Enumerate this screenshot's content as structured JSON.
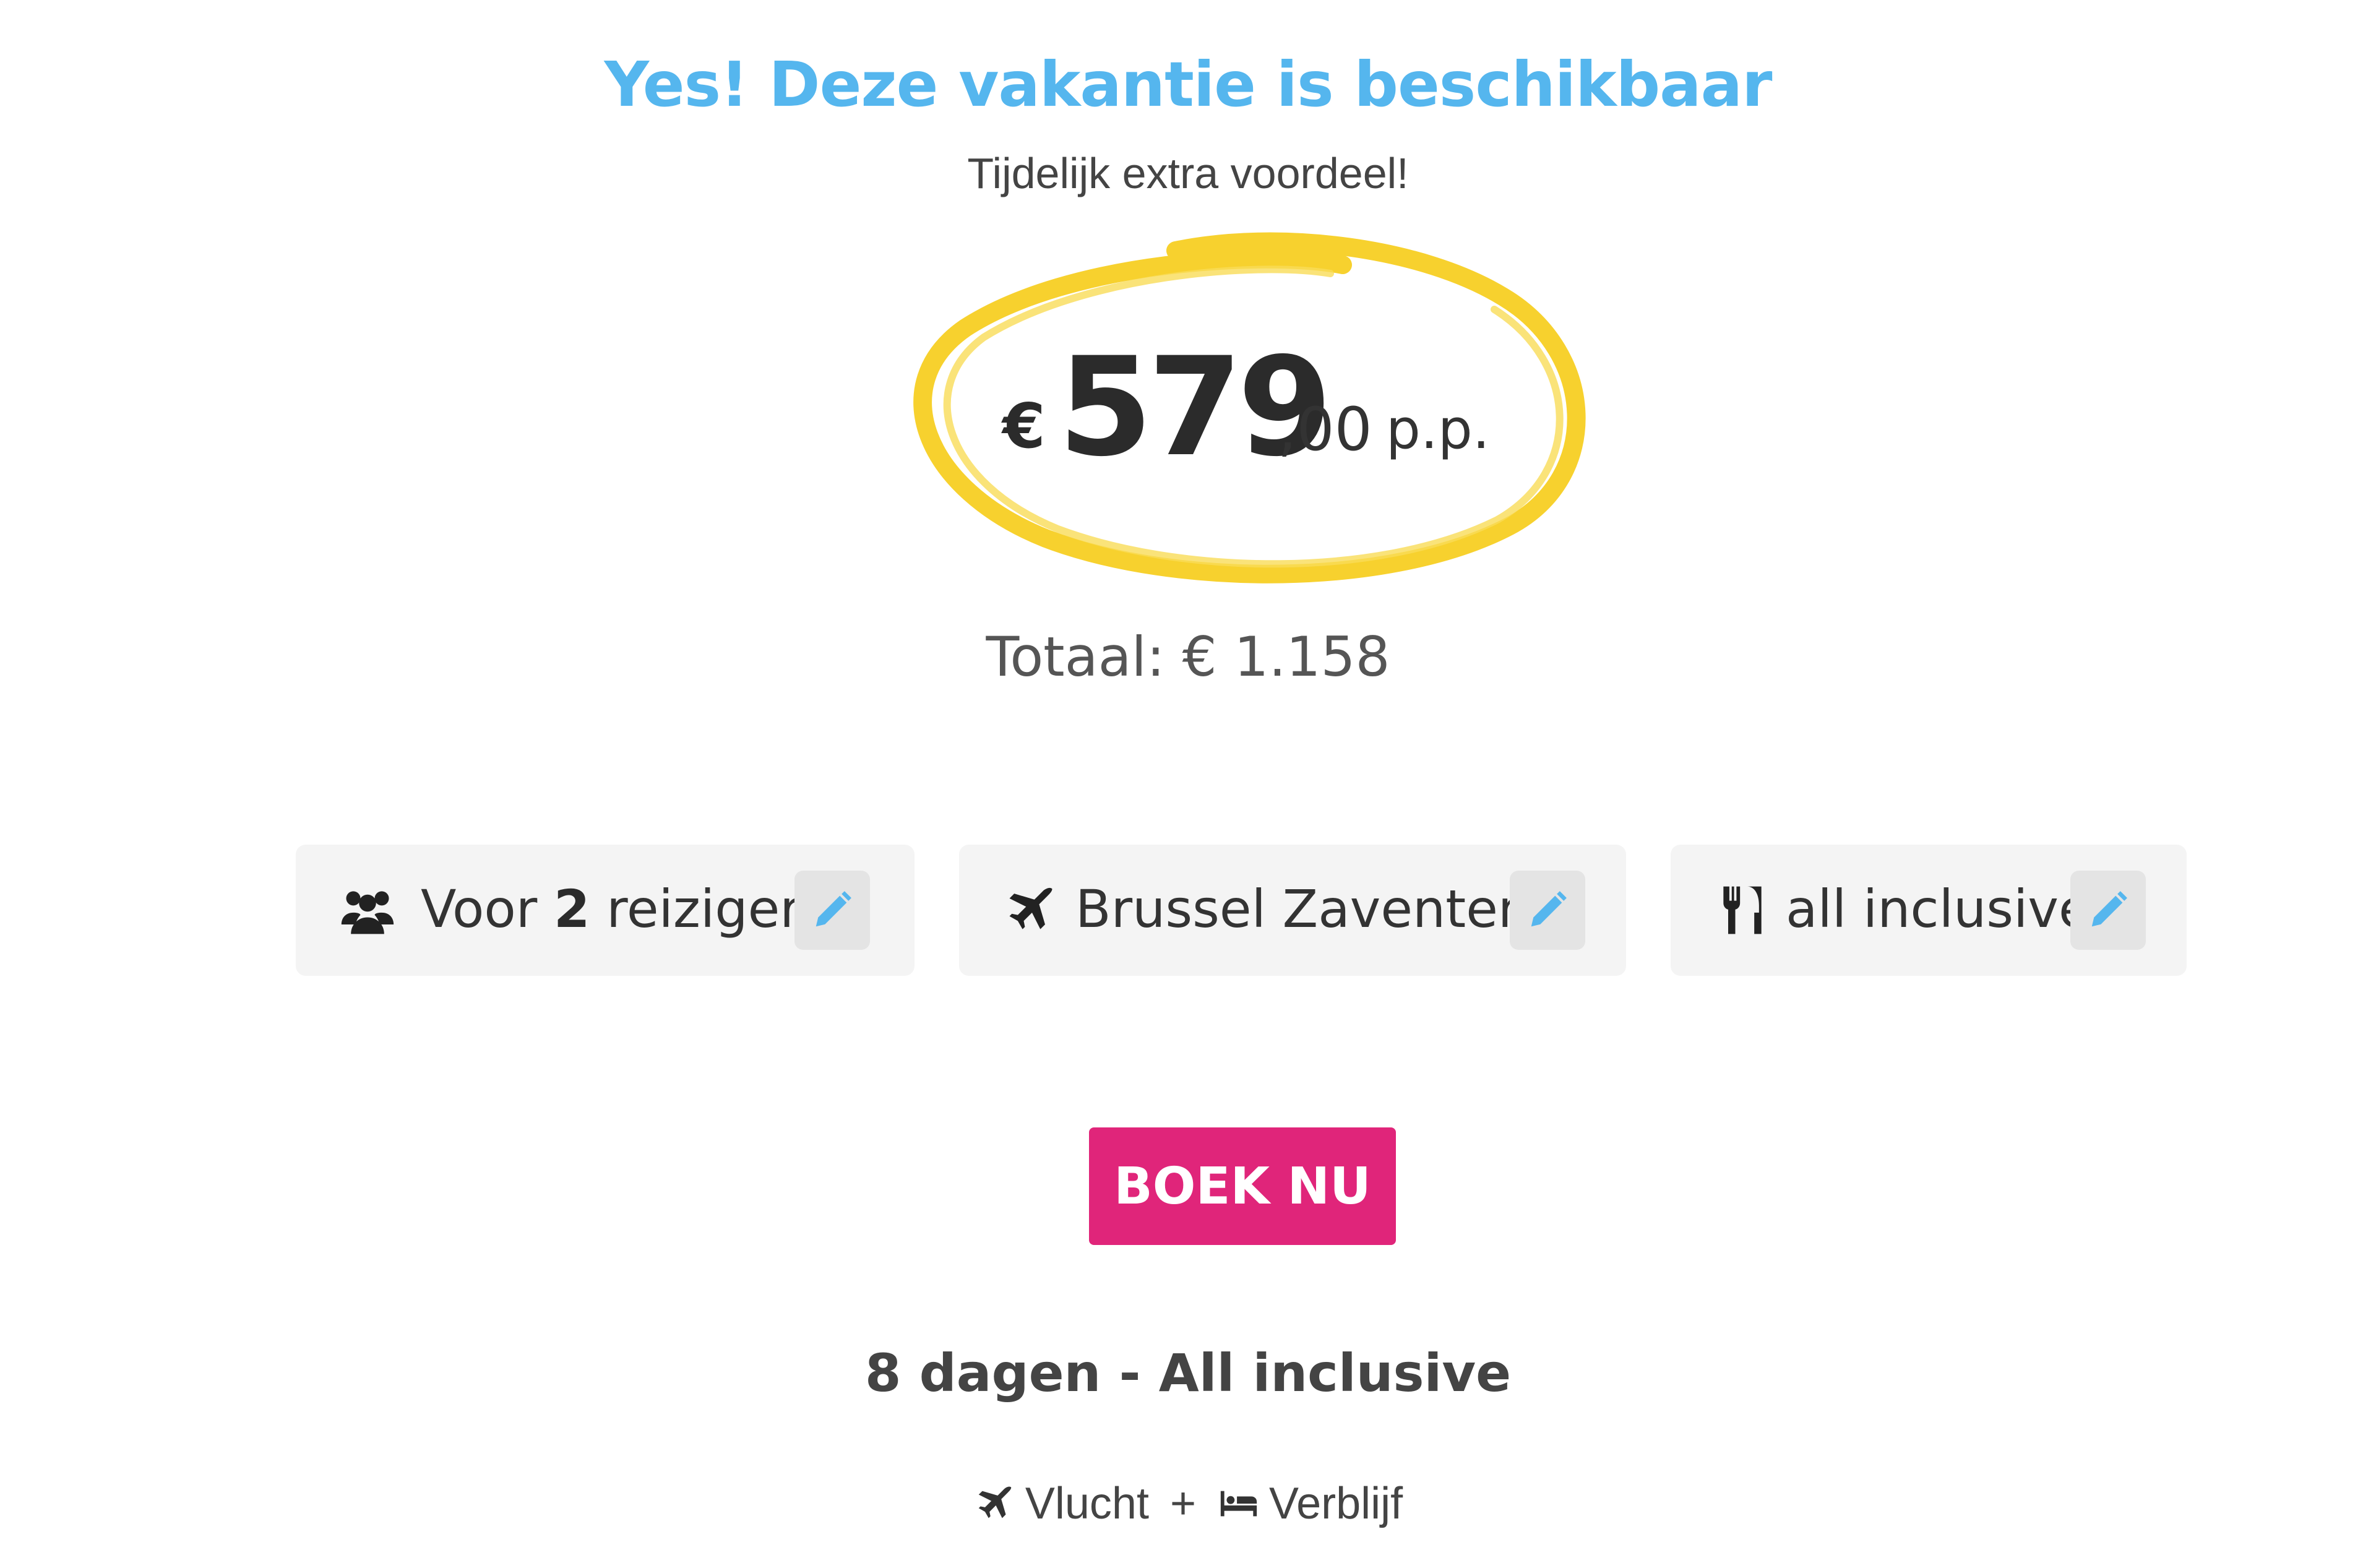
{
  "availability": {
    "headline": "Yes! Deze vakantie is beschikbaar",
    "promo": "Tijdelijk extra voordeel!"
  },
  "price": {
    "currency": "€",
    "amount": "579",
    "decimals": ",00",
    "unit": "p.p.",
    "total_label": "Totaal: € 1.158"
  },
  "options": [
    {
      "icon": "users-icon",
      "prefix": "Voor",
      "count": "2",
      "suffix": "reizigers"
    },
    {
      "icon": "plane-icon",
      "label": "Brussel Zaventem"
    },
    {
      "icon": "utensils-icon",
      "label": "all inclusive"
    }
  ],
  "cta": {
    "label": "BOEK NU"
  },
  "summary": {
    "duration": "8 dagen - All inclusive",
    "flight_label": "Vlucht",
    "plus": "+",
    "stay_label": "Verblijf"
  },
  "colors": {
    "headline": "#55b6ee",
    "highlight_circle": "#f7d12e",
    "cta": "#e0257a",
    "chip_bg": "#f4f4f4",
    "edit_icon": "#55b6ee"
  }
}
